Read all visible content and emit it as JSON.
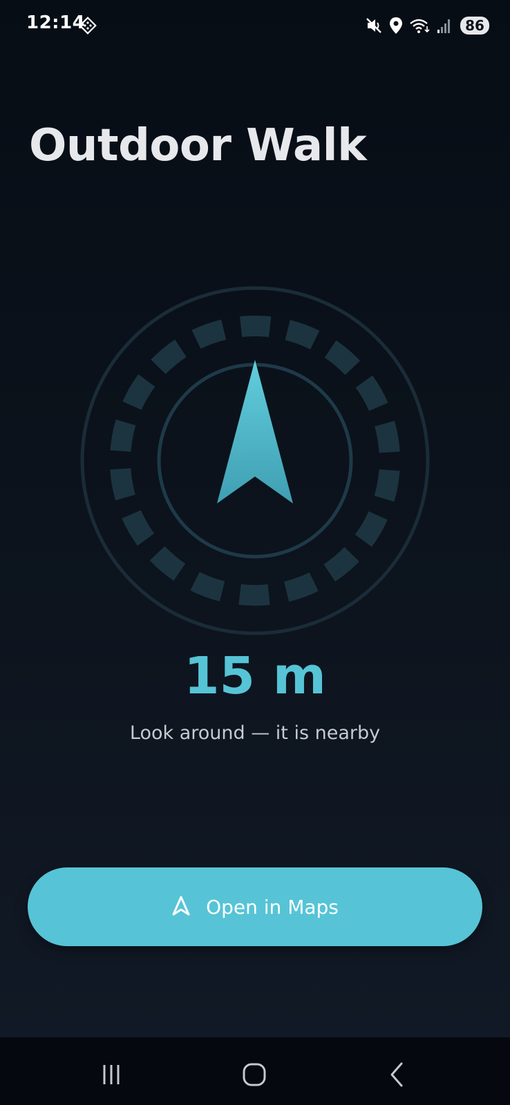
{
  "status_bar": {
    "time": "12:14",
    "battery_level": "86",
    "icons": [
      "gem-icon",
      "mute-icon",
      "location-icon",
      "wifi-icon",
      "signal-icon"
    ]
  },
  "page": {
    "title": "Outdoor Walk"
  },
  "compass": {
    "distance": "15 m",
    "hint": "Look around — it is nearby",
    "arrow_icon": "navigation-arrow-icon"
  },
  "actions": {
    "open_maps_label": "Open in Maps",
    "open_maps_icon": "navigation-outline-icon"
  },
  "nav_bar": {
    "icons": [
      "recent-apps-icon",
      "home-icon",
      "back-icon"
    ]
  },
  "colors": {
    "accent": "#56c4d6",
    "background": "#0b121b",
    "ring": "#1c3440",
    "dashes": "#1c3440"
  }
}
